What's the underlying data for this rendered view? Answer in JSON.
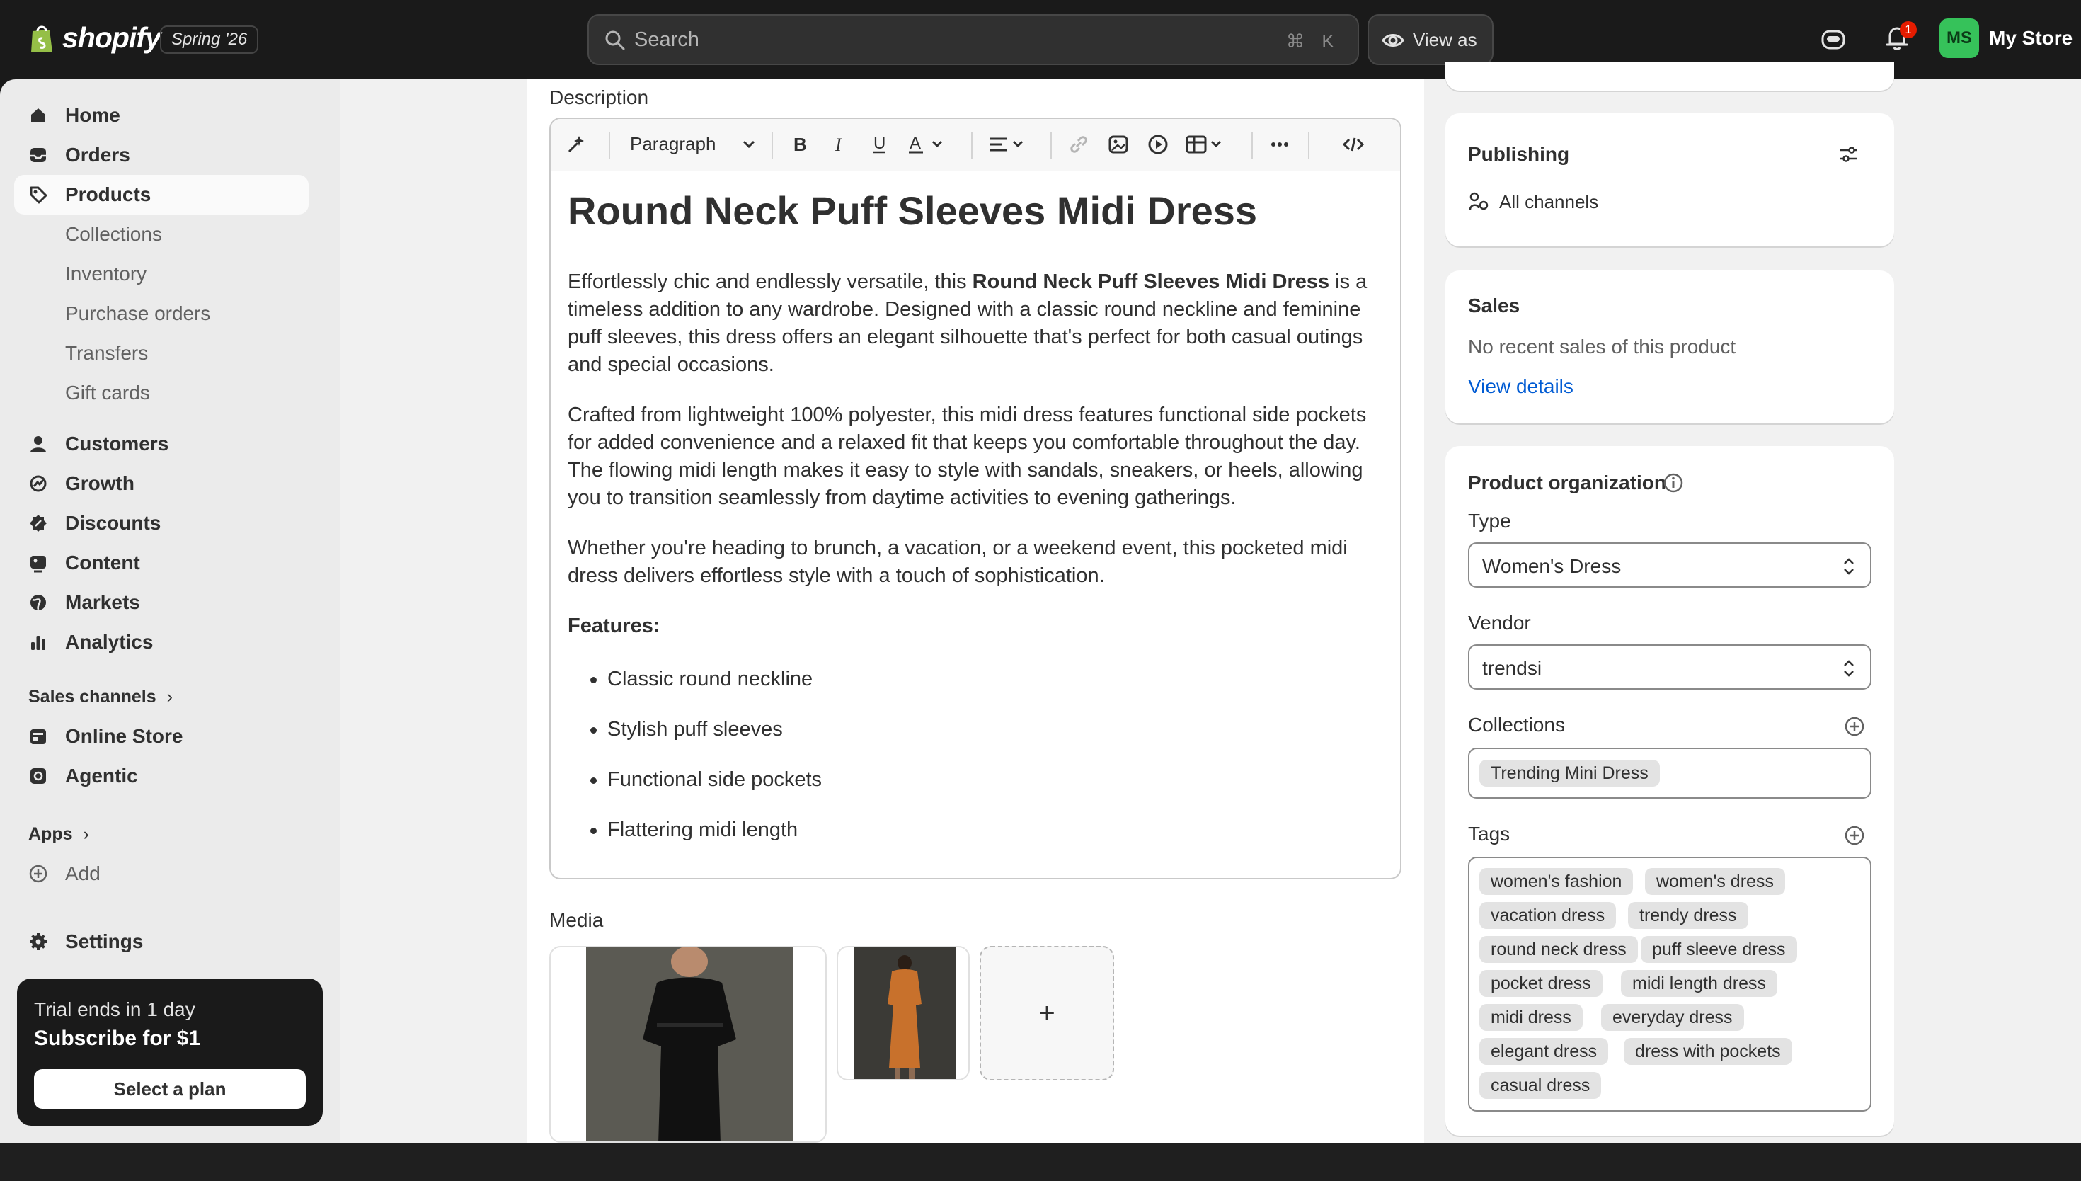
{
  "topbar": {
    "brand": "shopify",
    "edition_badge": "Spring '26",
    "search_placeholder": "Search",
    "search_shortcut_cmd": "⌘",
    "search_shortcut_key": "K",
    "view_as_label": "View as",
    "notification_count": "1",
    "avatar_initials": "MS",
    "store_name": "My Store"
  },
  "sidebar": {
    "items": [
      {
        "label": "Home",
        "icon": "home-icon"
      },
      {
        "label": "Orders",
        "icon": "inbox-icon"
      },
      {
        "label": "Products",
        "icon": "tag-icon",
        "active": true
      },
      {
        "label": "Collections"
      },
      {
        "label": "Inventory"
      },
      {
        "label": "Purchase orders"
      },
      {
        "label": "Transfers"
      },
      {
        "label": "Gift cards"
      },
      {
        "label": "Customers",
        "icon": "person-icon"
      },
      {
        "label": "Growth",
        "icon": "growth-icon"
      },
      {
        "label": "Discounts",
        "icon": "discount-icon"
      },
      {
        "label": "Content",
        "icon": "content-icon"
      },
      {
        "label": "Markets",
        "icon": "globe-icon"
      },
      {
        "label": "Analytics",
        "icon": "bar-chart-icon"
      }
    ],
    "sales_channels_title": "Sales channels",
    "channels": [
      {
        "label": "Online Store",
        "icon": "store-icon"
      },
      {
        "label": "Agentic",
        "icon": "agentic-icon"
      }
    ],
    "apps_title": "Apps",
    "add_label": "Add",
    "settings_label": "Settings",
    "trial": {
      "line1": "Trial ends in 1 day",
      "line2": "Subscribe for $1",
      "button": "Select a plan"
    }
  },
  "editor": {
    "section_label": "Description",
    "block_format": "Paragraph",
    "heading": "Round Neck Puff Sleeves Midi Dress",
    "p1_before": "Effortlessly chic and endlessly versatile, this ",
    "p1_bold": "Round Neck Puff Sleeves Midi Dress",
    "p1_after": " is a timeless addition to any wardrobe. Designed with a classic round neckline and feminine puff sleeves, this dress offers an elegant silhouette that's perfect for both casual outings and special occasions.",
    "p2": "Crafted from lightweight 100% polyester, this midi dress features functional side pockets for added convenience and a relaxed fit that keeps you comfortable throughout the day. The flowing midi length makes it easy to style with sandals, sneakers, or heels, allowing you to transition seamlessly from daytime activities to evening gatherings.",
    "p3": "Whether you're heading to brunch, a vacation, or a weekend event, this pocketed midi dress delivers effortless style with a touch of sophistication.",
    "features_title": "Features:",
    "features": [
      "Classic round neckline",
      "Stylish puff sleeves",
      "Functional side pockets",
      "Flattering midi length"
    ]
  },
  "media": {
    "label": "Media",
    "add_symbol": "+"
  },
  "publishing": {
    "title": "Publishing",
    "channels_label": "All channels"
  },
  "sales": {
    "title": "Sales",
    "empty_text": "No recent sales of this product",
    "link": "View details"
  },
  "organization": {
    "title": "Product organization",
    "type_label": "Type",
    "type_value": "Women's Dress",
    "vendor_label": "Vendor",
    "vendor_value": "trendsi",
    "collections_label": "Collections",
    "collections": [
      "Trending Mini Dress"
    ],
    "tags_label": "Tags",
    "tags": [
      "women's fashion",
      "women's dress",
      "vacation dress",
      "trendy dress",
      "round neck dress",
      "puff sleeve dress",
      "pocket dress",
      "midi length dress",
      "midi dress",
      "everyday dress",
      "elegant dress",
      "dress with pockets",
      "casual dress"
    ]
  },
  "colors": {
    "topbar": "#1a1a1a",
    "link": "#005bd3",
    "avatar": "#36c25a",
    "notification": "#e51c00"
  }
}
